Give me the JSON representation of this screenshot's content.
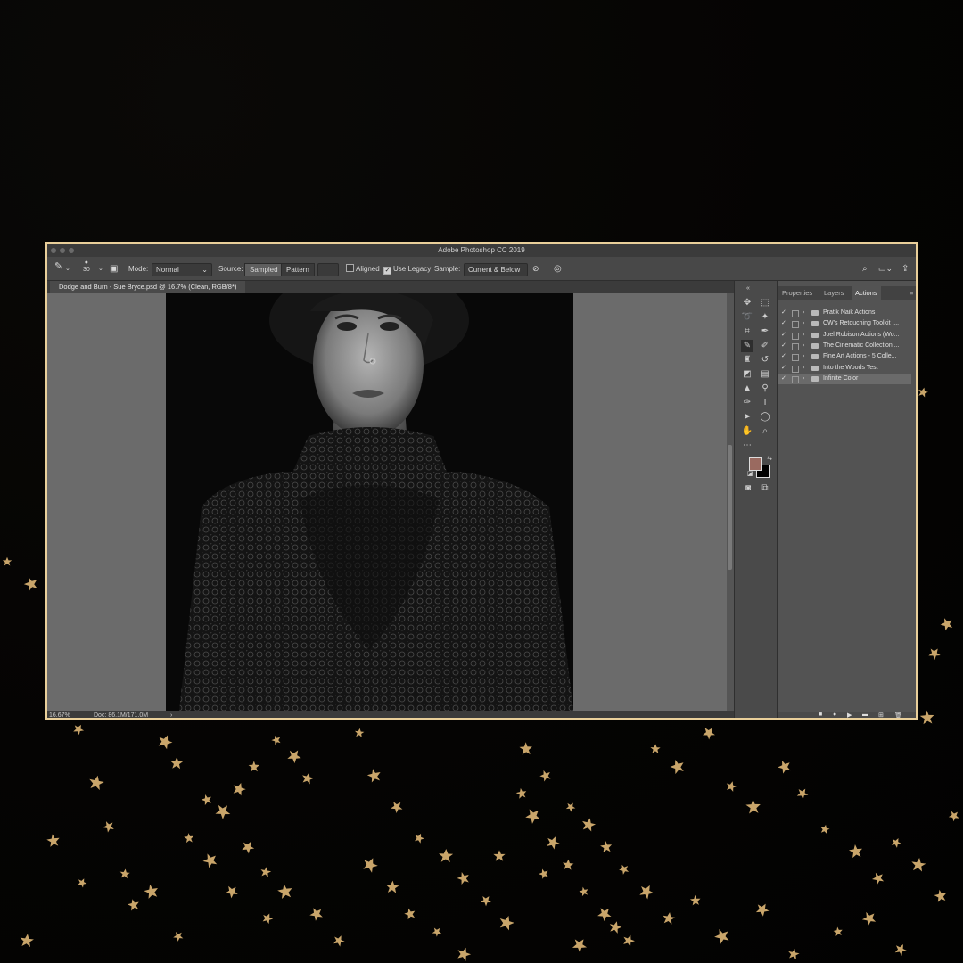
{
  "window": {
    "title": "Adobe Photoshop CC 2019"
  },
  "options_bar": {
    "brush_size": "30",
    "mode_label": "Mode:",
    "mode_value": "Normal",
    "source_label": "Source:",
    "source_sampled": "Sampled",
    "source_pattern": "Pattern",
    "aligned_label": "Aligned",
    "use_legacy_label": "Use Legacy",
    "sample_label": "Sample:",
    "sample_value": "Current & Below"
  },
  "document": {
    "tab_label": "Dodge and Burn - Sue Bryce.psd @ 16.7% (Clean, RGB/8*)",
    "zoom": "16.67%",
    "doc_size": "Doc: 86.1M/171.0M"
  },
  "panel": {
    "tabs": [
      "Properties",
      "Layers",
      "Actions"
    ],
    "active_tab": "Actions",
    "actions": [
      {
        "name": "Pratik Naik Actions",
        "checked": true
      },
      {
        "name": "CW's Retouching Toolkit |...",
        "checked": true
      },
      {
        "name": "Joel Robison Actions (Wo...",
        "checked": true
      },
      {
        "name": "The Cinematic Collection ...",
        "checked": true
      },
      {
        "name": "Fine Art Actions - 5 Colle...",
        "checked": true
      },
      {
        "name": "Into the Woods Test",
        "checked": true
      },
      {
        "name": "Infinite Color",
        "checked": true,
        "selected": true
      }
    ]
  },
  "colors": {
    "frame_border": "#e9cf9a",
    "foreground_swatch": "#9a6a60",
    "background_swatch": "#000000",
    "star": "#c9a56a"
  },
  "tools": [
    "move-icon",
    "marquee-icon",
    "lasso-icon",
    "magic-wand-icon",
    "crop-icon",
    "eyedropper-icon",
    "healing-brush-icon",
    "brush-icon",
    "clone-stamp-icon",
    "history-brush-icon",
    "eraser-icon",
    "gradient-icon",
    "blur-icon",
    "dodge-icon",
    "pen-icon",
    "type-icon",
    "path-select-icon",
    "shape-icon",
    "hand-icon",
    "zoom-icon",
    "more-tools-icon"
  ]
}
